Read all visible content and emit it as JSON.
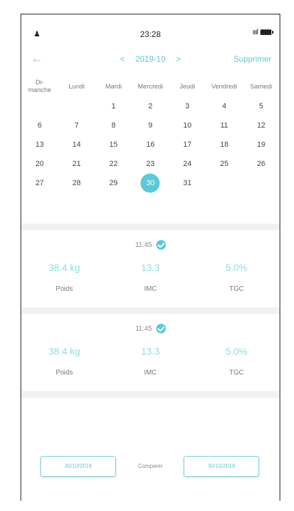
{
  "status": {
    "left": "♟",
    "time": "23:28",
    "signal": "ıııl"
  },
  "nav": {
    "back": "←",
    "prev": "<",
    "month": "2019-10",
    "next": ">",
    "delete": "Supprimer"
  },
  "weekdays": [
    "Di-\nmanche",
    "Lundi",
    "Mardi",
    "Mercredi",
    "Jeudi",
    "Vendredi",
    "Samedi"
  ],
  "weeks": [
    [
      "",
      "",
      "1",
      "2",
      "3",
      "4",
      "5"
    ],
    [
      "6",
      "7",
      "8",
      "9",
      "10",
      "11",
      "12"
    ],
    [
      "13",
      "14",
      "15",
      "16",
      "17",
      "18",
      "19"
    ],
    [
      "20",
      "21",
      "22",
      "23",
      "24",
      "25",
      "26"
    ],
    [
      "27",
      "28",
      "29",
      "30",
      "31",
      "",
      ""
    ]
  ],
  "selected_day": "30",
  "entries": [
    {
      "time": "11:45",
      "weight": "38.4 kg",
      "bmi": "13.3",
      "fat": "5.0%",
      "weight_label": "Poids",
      "bmi_label": "IMC",
      "fat_label": "TGC"
    },
    {
      "time": "11:45",
      "weight": "38.4 kg",
      "bmi": "13.3",
      "fat": "5.0%",
      "weight_label": "Poids",
      "bmi_label": "IMC",
      "fat_label": "TGC"
    }
  ],
  "compare": {
    "from": "30/10/2019",
    "label": "Comparer",
    "to": "30/10/2019"
  },
  "colors": {
    "accent": "#5cc9d6",
    "light_accent": "#8fdbe4"
  }
}
